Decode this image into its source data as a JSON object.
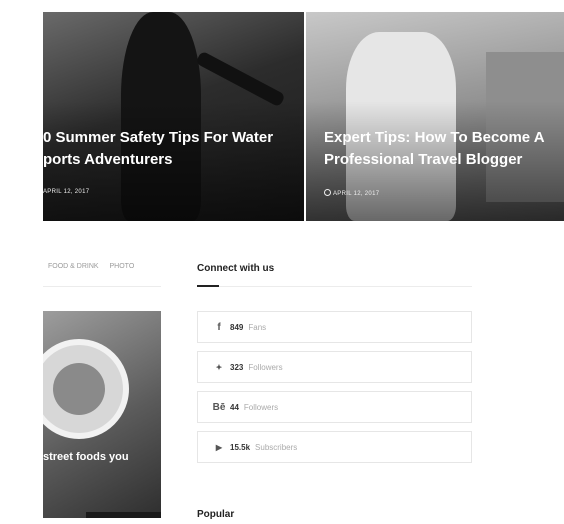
{
  "featured": [
    {
      "title_line1": "0 Summer Safety Tips For Water",
      "title_line2": "ports Adventurers",
      "date": "APRIL 12, 2017"
    },
    {
      "title_line1": "Expert Tips: How To Become A",
      "title_line2": "Professional Travel Blogger",
      "date": "APRIL 12, 2017"
    }
  ],
  "categories": [
    "FOOD & DRINK",
    "PHOTO"
  ],
  "post": {
    "title": "street foods you"
  },
  "connect": {
    "title": "Connect with us",
    "items": [
      {
        "icon": "facebook-icon",
        "glyph": "f",
        "count": "849",
        "label": "Fans"
      },
      {
        "icon": "twitter-icon",
        "glyph": "🐦",
        "count": "323",
        "label": "Followers"
      },
      {
        "icon": "behance-icon",
        "glyph": "Bē",
        "count": "44",
        "label": "Followers"
      },
      {
        "icon": "youtube-icon",
        "glyph": "▶",
        "count": "15.5k",
        "label": "Subscribers"
      }
    ]
  },
  "popular": {
    "title": "Popular"
  }
}
